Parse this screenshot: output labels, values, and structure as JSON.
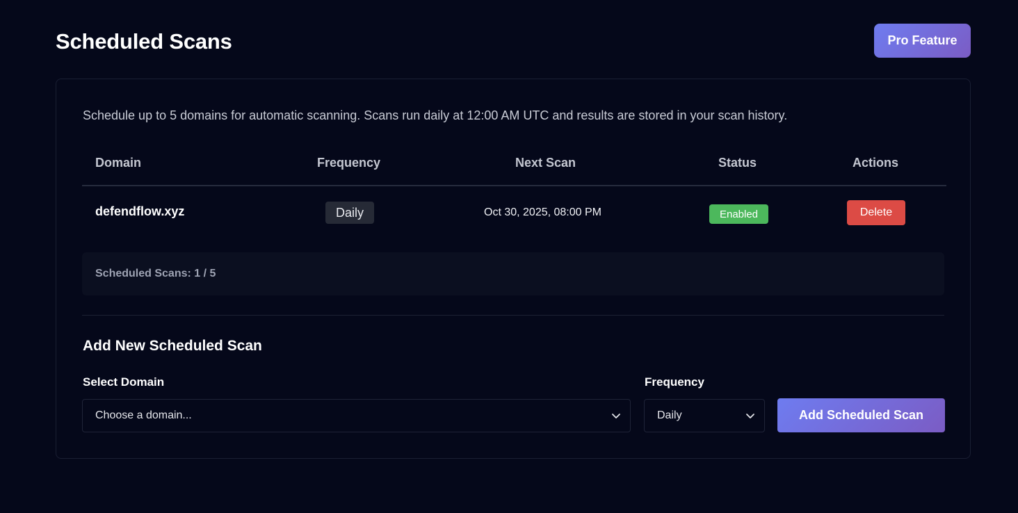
{
  "header": {
    "title": "Scheduled Scans",
    "pro_badge": "Pro Feature"
  },
  "panel": {
    "description": "Schedule up to 5 domains for automatic scanning. Scans run daily at 12:00 AM UTC and results are stored in your scan history."
  },
  "table": {
    "columns": [
      "Domain",
      "Frequency",
      "Next Scan",
      "Status",
      "Actions"
    ],
    "rows": [
      {
        "domain": "defendflow.xyz",
        "frequency": "Daily",
        "next_scan": "Oct 30, 2025, 08:00 PM",
        "status": "Enabled",
        "action": "Delete"
      }
    ]
  },
  "summary": {
    "text": "Scheduled Scans: 1 / 5"
  },
  "add_form": {
    "title": "Add New Scheduled Scan",
    "domain_label": "Select Domain",
    "domain_value": "Choose a domain...",
    "frequency_label": "Frequency",
    "frequency_value": "Daily",
    "submit_label": "Add Scheduled Scan"
  },
  "colors": {
    "background": "#05081a",
    "accent_gradient_start": "#6e7cf0",
    "accent_gradient_end": "#7b5cc4",
    "status_enabled": "#4cb85c",
    "delete": "#dc4b45"
  },
  "icons": {
    "select_chevron": "chevron-down-icon"
  }
}
